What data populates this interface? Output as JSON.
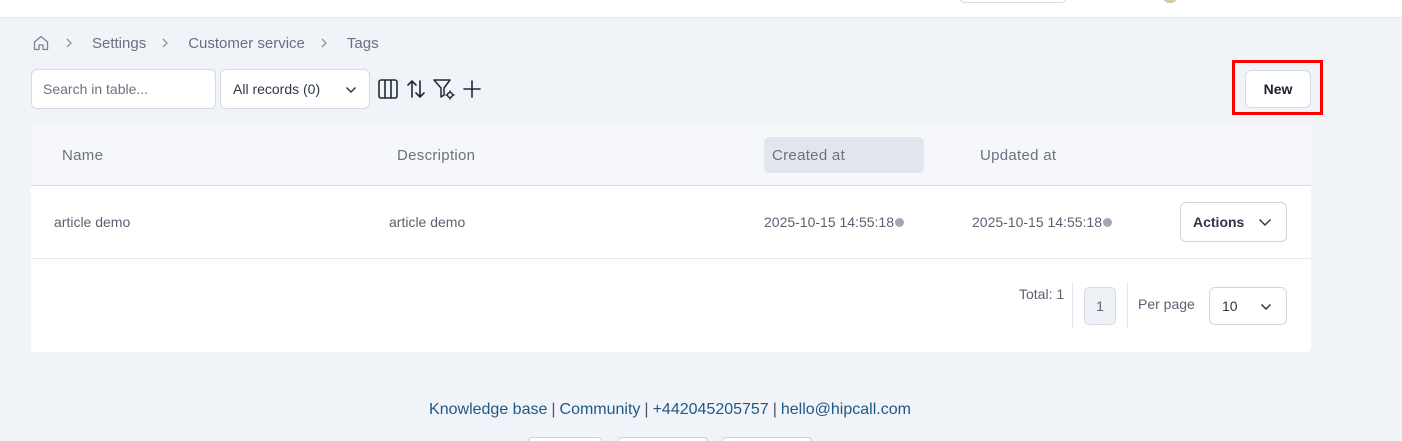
{
  "breadcrumb": {
    "items": [
      "Settings",
      "Customer service",
      "Tags"
    ]
  },
  "toolbar": {
    "search_placeholder": "Search in table...",
    "records_selected": "All records (0)",
    "icons": [
      "columns-icon",
      "sort-icon",
      "filter-settings-icon",
      "plus-icon"
    ]
  },
  "new_button": {
    "label": "New"
  },
  "table": {
    "columns": [
      "Name",
      "Description",
      "Created at",
      "Updated at"
    ],
    "rows": [
      {
        "name": "article demo",
        "description": "article demo",
        "created_at": "2025-10-15 14:55:18",
        "updated_at": "2025-10-15 14:55:18",
        "actions_label": "Actions"
      }
    ]
  },
  "pagination": {
    "total_label": "Total: 1",
    "current_page": "1",
    "per_page_label": "Per page",
    "per_page_value": "10"
  },
  "footer": {
    "links": [
      "Knowledge base",
      "Community",
      "+442045205757",
      "hello@hipcall.com"
    ],
    "separator": "|"
  },
  "colors": {
    "background": "#f0f3f7",
    "highlight": "#ff0000",
    "link": "#1f5986"
  }
}
